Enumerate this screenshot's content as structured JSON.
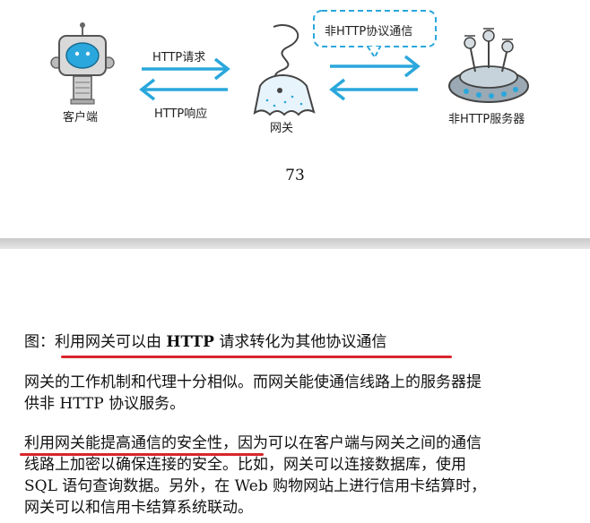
{
  "diagram": {
    "client_label": "客户端",
    "gateway_label": "网关",
    "server_label": "非HTTP服务器",
    "request_label": "HTTP请求",
    "response_label": "HTTP响应",
    "protocol_label": "非HTTP协议通信"
  },
  "page_number": "73",
  "caption": {
    "prefix": "图：",
    "part1": "利用网关可以由 ",
    "http": "HTTP",
    "part2": " 请求转化为其他协议通信"
  },
  "paragraph1": {
    "line1": "网关的工作机制和代理十分相似。而网关能使通信线路上的服务器提",
    "line2": "供非 HTTP 协议服务。"
  },
  "paragraph2": {
    "line1a": "利用网关能提高通信的安全性",
    "line1b": "，因为可以在客户端与网关之间的通信",
    "line2": "线路上加密以确保连接的安全。比如，网关可以连接数据库，使用",
    "line3": "SQL 语句查询数据。另外，在 Web 购物网站上进行信用卡结算时，",
    "line4": "网关可以和信用卡结算系统联动。"
  },
  "colors": {
    "accent_blue": "#2aa7dc",
    "underline_red": "#d8262d"
  }
}
